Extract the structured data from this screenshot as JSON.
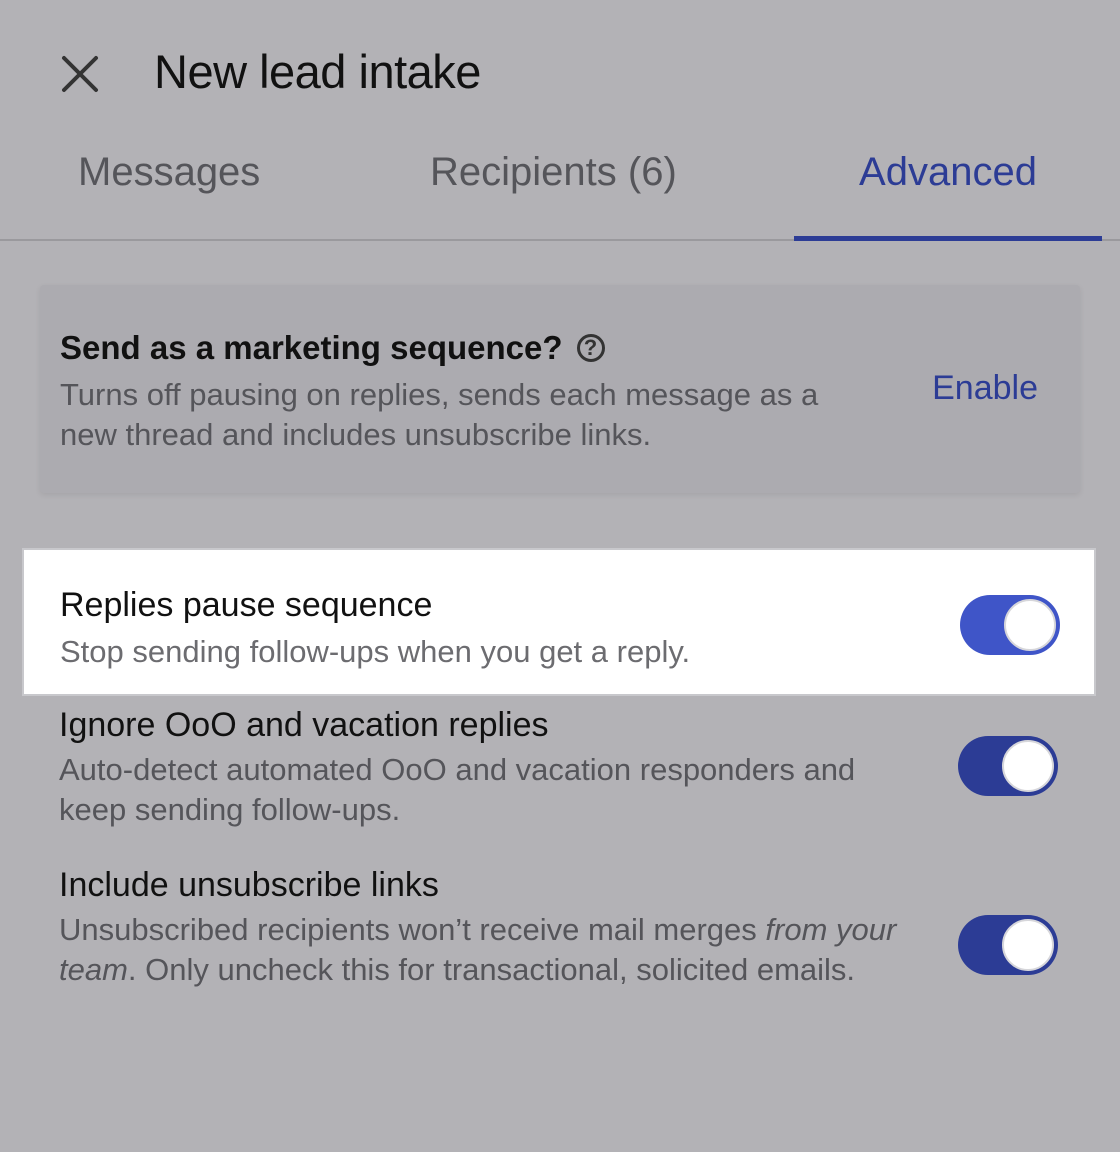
{
  "header": {
    "title": "New lead intake",
    "close_icon": "close-icon"
  },
  "tabs": [
    {
      "label": "Messages",
      "active": false
    },
    {
      "label": "Recipients (6)",
      "active": false
    },
    {
      "label": "Advanced",
      "active": true
    }
  ],
  "marketing": {
    "title": "Send as a marketing sequence?",
    "help_icon": "help-icon",
    "help_glyph": "?",
    "description": "Turns off pausing on replies, sends each message as a new thread and includes unsubscribe links.",
    "action_label": "Enable"
  },
  "settings": [
    {
      "title": "Replies pause sequence",
      "description": "Stop sending follow-ups when you get a reply.",
      "enabled": true
    },
    {
      "title": "Ignore OoO and vacation replies",
      "description": "Auto-detect automated OoO and vacation responders and keep sending follow-ups.",
      "enabled": true
    },
    {
      "title": "Include unsubscribe links",
      "description_parts": {
        "before": "Unsubscribed recipients won’t receive mail merges ",
        "emphasis": "from your team",
        "after": ". Only uncheck this for transactional, solicited emails."
      },
      "enabled": true
    }
  ],
  "colors": {
    "accent": "#2c3c95",
    "toggle_active": "#3f55c8",
    "overlay_background": "#b3b2b6"
  }
}
